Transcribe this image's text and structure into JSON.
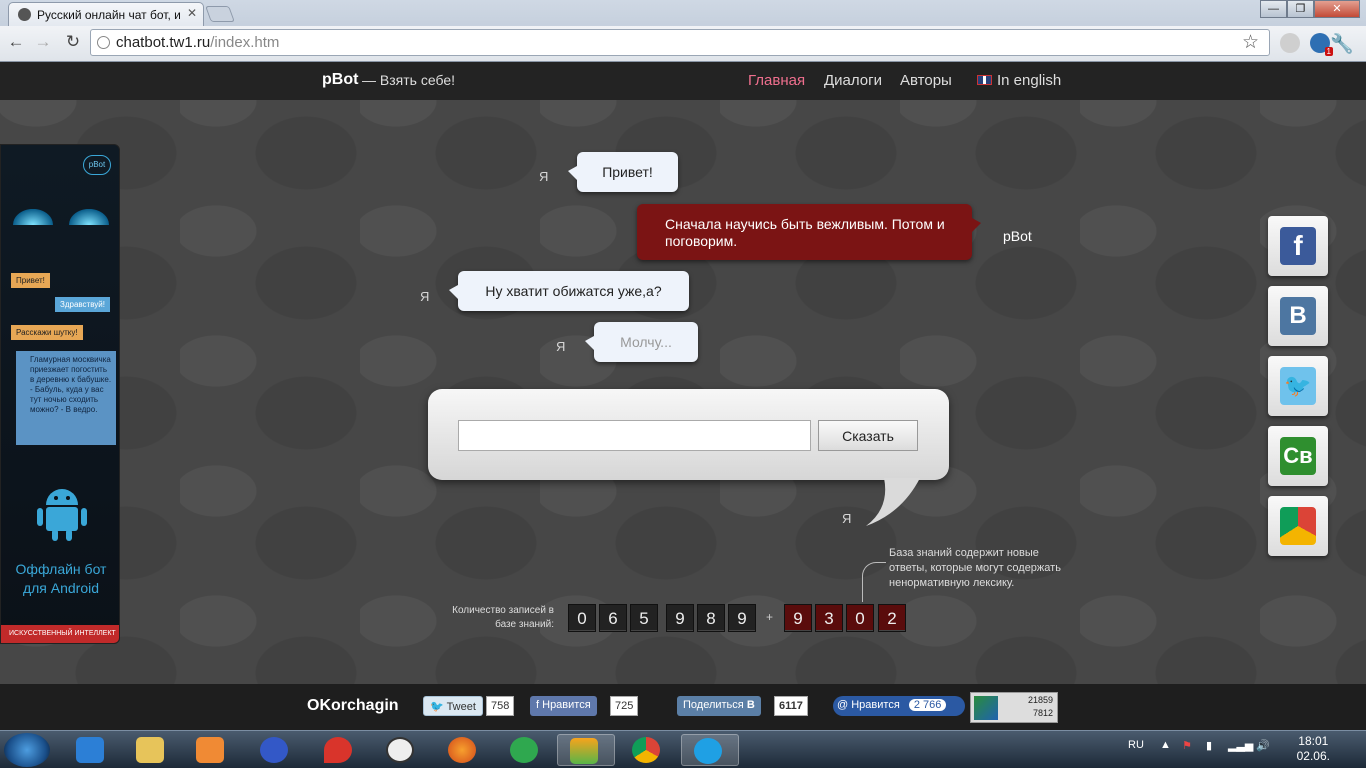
{
  "browser": {
    "tab_title": "Русский онлайн чат бот, и",
    "url_host": "chatbot.tw1.ru",
    "url_path": "/index.htm",
    "extension_badge": "1"
  },
  "header": {
    "logo": "pBot",
    "tagline": "— Взять себе!",
    "nav": [
      "Главная",
      "Диалоги",
      "Авторы",
      "In english"
    ]
  },
  "side_banner": {
    "pbot_badge": "pBot",
    "chat": [
      "Привет!",
      "Здравствуй!",
      "Расскажи шутку!"
    ],
    "joke": "Гламурная москвичка приезжает погостить в деревню к бабушке. - Бабуль, куда у вас тут ночью сходить можно? - В ведро.",
    "title_line1": "Оффлайн бот",
    "title_line2": "для Android",
    "strip": "ИСКУССТВЕННЫЙ ИНТЕЛЛЕКТ"
  },
  "chat": {
    "messages": [
      {
        "speaker": "Я",
        "text": "Привет!"
      },
      {
        "speaker": "pBot",
        "text": "Сначала научись быть вежливым. Потом и поговорим."
      },
      {
        "speaker": "Я",
        "text": "Ну хватит обижатся уже,а?"
      },
      {
        "speaker": "Я",
        "text": "Молчу..."
      }
    ],
    "input_value": "",
    "say_button": "Сказать",
    "input_speaker": "Я"
  },
  "knowledge": {
    "label": "Количество записей в базе знаний:",
    "digits_main": [
      "0",
      "6",
      "5",
      "9",
      "8",
      "9"
    ],
    "plus": "+",
    "digits_new": [
      "9",
      "3",
      "0",
      "2"
    ],
    "note": "База знаний содержит новые ответы, которые могут содержать ненормативную лексику."
  },
  "social_icons": [
    "facebook-icon",
    "vkontakte-icon",
    "twitter-icon",
    "cb-icon",
    "chrome-store-icon"
  ],
  "footer": {
    "author": "OKorchagin",
    "tweet_label": "Tweet",
    "tweet_count": "758",
    "fb_like_label": "Нравится",
    "fb_like_count": "725",
    "vk_share_label": "Поделиться",
    "vk_share_count": "6117",
    "mail_like_label": "Нравится",
    "mail_like_count": "2 766",
    "liveinternet_line1": "21859",
    "liveinternet_line2": "7812"
  },
  "taskbar": {
    "lang": "RU",
    "time": "18:01",
    "date": "02.06."
  },
  "colors": {
    "accent_nav": "#ef6f8e",
    "bot_bubble": "#7b1414",
    "user_bubble": "#eef3fb"
  }
}
